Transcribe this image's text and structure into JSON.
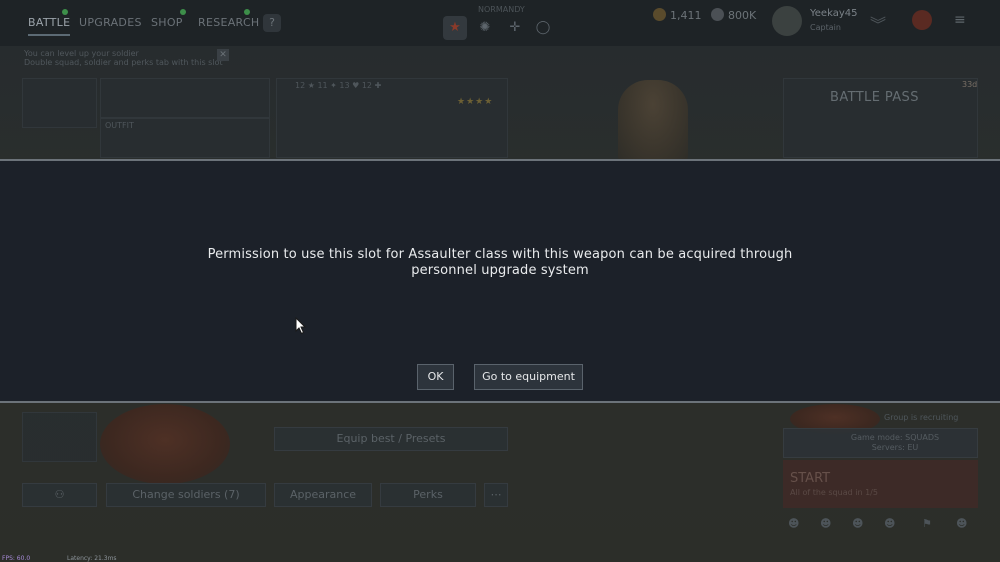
{
  "topbar": {
    "tabs": [
      {
        "label": "BATTLE",
        "active": true
      },
      {
        "label": "UPGRADES",
        "active": false
      },
      {
        "label": "SHOP",
        "active": false
      },
      {
        "label": "RESEARCH",
        "active": false
      }
    ],
    "help_label": "?",
    "mode_label": "NORMANDY",
    "currencies": [
      {
        "name": "gold",
        "value": "1,411",
        "color": "#b28a3a"
      },
      {
        "name": "silver",
        "value": "800K",
        "color": "#8a9096"
      }
    ],
    "player": {
      "name": "Yeekay45",
      "rank": "Captain"
    }
  },
  "hint": {
    "line1": "You can level up your soldier",
    "line2": "Double squad, soldier and perks tab with this slot"
  },
  "battle_pass": {
    "title": "BATTLE PASS",
    "time_top": "33d",
    "time_bottom": "2d 20h"
  },
  "loadout": {
    "outfit_label": "OUTFIT",
    "stats": "12 ★ 11 ✦ 13 ♥ 12 ✚",
    "equip_best_label": "Equip best / Presets",
    "change_soldiers_label": "Change soldiers (7)",
    "appearance_label": "Appearance",
    "perks_label": "Perks"
  },
  "start_panel": {
    "group_label": "Group is recruiting",
    "mode_line1": "Game mode: SQUADS",
    "mode_line2": "Servers: EU",
    "start_label": "START",
    "start_sub": "All of the squad in 1/5"
  },
  "debug": {
    "fps": "FPS: 60.0",
    "latency": "Latency:  21.3ms"
  },
  "dialog": {
    "message": "Permission to use this slot for Assaulter class with this weapon can be acquired through personnel upgrade system",
    "ok_label": "OK",
    "equipment_label": "Go to equipment"
  }
}
